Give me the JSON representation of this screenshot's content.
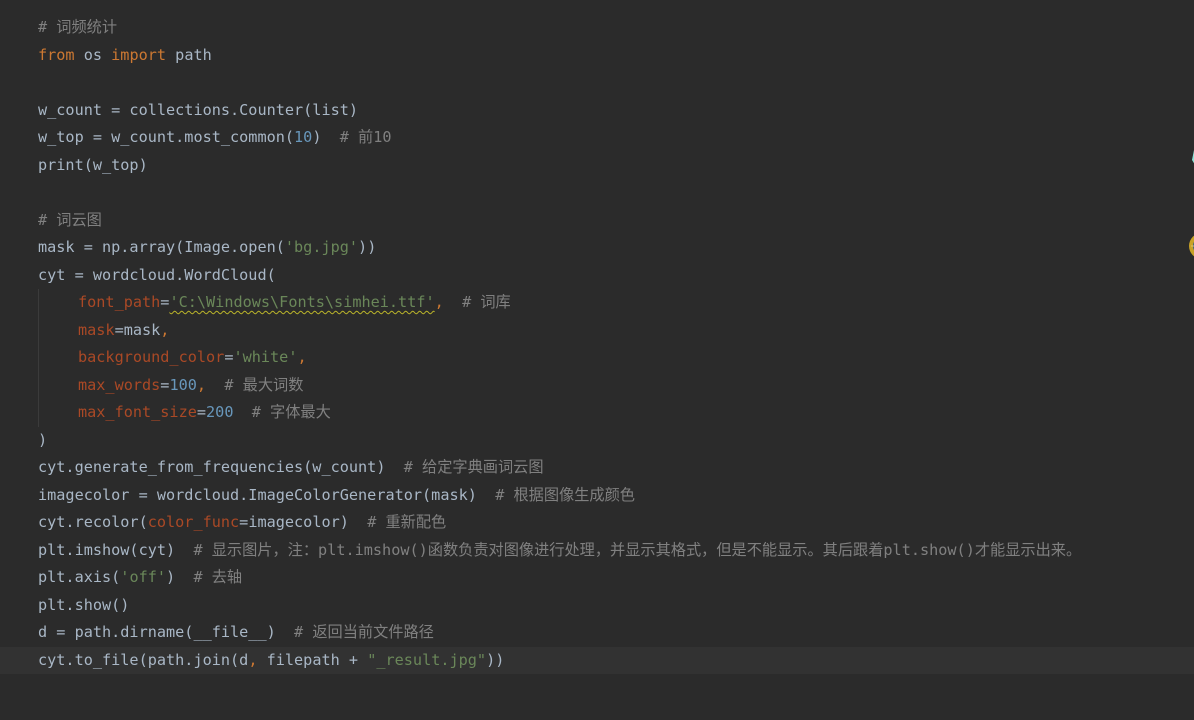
{
  "editor": {
    "current_line_index": 23,
    "lines": [
      {
        "indent": false,
        "tokens": [
          {
            "k": "cmt",
            "t": "# 词频统计"
          }
        ]
      },
      {
        "indent": false,
        "tokens": [
          {
            "k": "kw",
            "t": "from"
          },
          {
            "k": "plain",
            "t": " os "
          },
          {
            "k": "kw",
            "t": "import"
          },
          {
            "k": "plain",
            "t": " path"
          }
        ]
      },
      {
        "indent": false,
        "tokens": []
      },
      {
        "indent": false,
        "tokens": [
          {
            "k": "plain",
            "t": "w_count = collections.Counter(list)"
          }
        ]
      },
      {
        "indent": false,
        "tokens": [
          {
            "k": "plain",
            "t": "w_top = w_count.most_common("
          },
          {
            "k": "num",
            "t": "10"
          },
          {
            "k": "plain",
            "t": ")  "
          },
          {
            "k": "cmt",
            "t": "# 前10"
          }
        ]
      },
      {
        "indent": false,
        "tokens": [
          {
            "k": "plain",
            "t": "print(w_top)"
          }
        ]
      },
      {
        "indent": false,
        "tokens": []
      },
      {
        "indent": false,
        "tokens": [
          {
            "k": "cmt",
            "t": "# 词云图"
          }
        ]
      },
      {
        "indent": false,
        "tokens": [
          {
            "k": "plain",
            "t": "mask = np.array(Image.open("
          },
          {
            "k": "str",
            "t": "'bg.jpg'"
          },
          {
            "k": "plain",
            "t": "))"
          }
        ]
      },
      {
        "indent": false,
        "tokens": [
          {
            "k": "plain",
            "t": "cyt = wordcloud.WordCloud("
          }
        ]
      },
      {
        "indent": true,
        "tokens": [
          {
            "k": "param",
            "t": "font_path"
          },
          {
            "k": "plain",
            "t": "="
          },
          {
            "k": "str",
            "wavy": true,
            "t": "'C:\\Windows\\Fonts\\simhei.ttf'"
          },
          {
            "k": "kw",
            "t": ","
          },
          {
            "k": "plain",
            "t": "  "
          },
          {
            "k": "cmt",
            "t": "# 词库"
          }
        ]
      },
      {
        "indent": true,
        "tokens": [
          {
            "k": "param",
            "t": "mask"
          },
          {
            "k": "plain",
            "t": "=mask"
          },
          {
            "k": "kw",
            "t": ","
          }
        ]
      },
      {
        "indent": true,
        "tokens": [
          {
            "k": "param",
            "t": "background_color"
          },
          {
            "k": "plain",
            "t": "="
          },
          {
            "k": "str",
            "t": "'white'"
          },
          {
            "k": "kw",
            "t": ","
          }
        ]
      },
      {
        "indent": true,
        "tokens": [
          {
            "k": "param",
            "t": "max_words"
          },
          {
            "k": "plain",
            "t": "="
          },
          {
            "k": "num",
            "t": "100"
          },
          {
            "k": "kw",
            "t": ","
          },
          {
            "k": "plain",
            "t": "  "
          },
          {
            "k": "cmt",
            "t": "# 最大词数"
          }
        ]
      },
      {
        "indent": true,
        "tokens": [
          {
            "k": "param",
            "t": "max_font_size"
          },
          {
            "k": "plain",
            "t": "="
          },
          {
            "k": "num",
            "t": "200"
          },
          {
            "k": "plain",
            "t": "  "
          },
          {
            "k": "cmt",
            "t": "# 字体最大"
          }
        ]
      },
      {
        "indent": false,
        "tokens": [
          {
            "k": "plain",
            "t": ")"
          }
        ]
      },
      {
        "indent": false,
        "tokens": [
          {
            "k": "plain",
            "t": "cyt.generate_from_frequencies(w_count)  "
          },
          {
            "k": "cmt",
            "t": "# 给定字典画词云图"
          }
        ]
      },
      {
        "indent": false,
        "tokens": [
          {
            "k": "plain",
            "t": "imagecolor = wordcloud.ImageColorGenerator(mask)  "
          },
          {
            "k": "cmt",
            "t": "# 根据图像生成颜色"
          }
        ]
      },
      {
        "indent": false,
        "tokens": [
          {
            "k": "plain",
            "t": "cyt.recolor("
          },
          {
            "k": "param",
            "t": "color_func"
          },
          {
            "k": "plain",
            "t": "=imagecolor)  "
          },
          {
            "k": "cmt",
            "t": "# 重新配色"
          }
        ]
      },
      {
        "indent": false,
        "tokens": [
          {
            "k": "plain",
            "t": "plt.imshow(cyt)  "
          },
          {
            "k": "cmt",
            "t": "# 显示图片，注：plt.imshow()函数负责对图像进行处理，并显示其格式，但是不能显示。其后跟着plt.show()才能显示出来。"
          }
        ]
      },
      {
        "indent": false,
        "tokens": [
          {
            "k": "plain",
            "t": "plt.axis("
          },
          {
            "k": "str",
            "t": "'off'"
          },
          {
            "k": "plain",
            "t": ")  "
          },
          {
            "k": "cmt",
            "t": "# 去轴"
          }
        ]
      },
      {
        "indent": false,
        "tokens": [
          {
            "k": "plain",
            "t": "plt.show()"
          }
        ]
      },
      {
        "indent": false,
        "tokens": [
          {
            "k": "plain",
            "t": "d = path.dirname(__file__)  "
          },
          {
            "k": "cmt",
            "t": "# 返回当前文件路径"
          }
        ]
      },
      {
        "indent": false,
        "tokens": [
          {
            "k": "plain",
            "t": "cyt.to_file(path.join(d"
          },
          {
            "k": "kw",
            "t": ","
          },
          {
            "k": "plain",
            "t": " filepath + "
          },
          {
            "k": "str",
            "t": "\"_result.jpg\""
          },
          {
            "k": "plain",
            "t": "))"
          }
        ]
      }
    ]
  },
  "mascot": {
    "icon": "anime-mascot-icon"
  },
  "colors": {
    "background": "#2b2b2b",
    "current_line": "#323232",
    "plain": "#a9b7c6",
    "keyword": "#cc7832",
    "string": "#6a8759",
    "number": "#6897bb",
    "param": "#aa4926",
    "comment": "#808080"
  }
}
